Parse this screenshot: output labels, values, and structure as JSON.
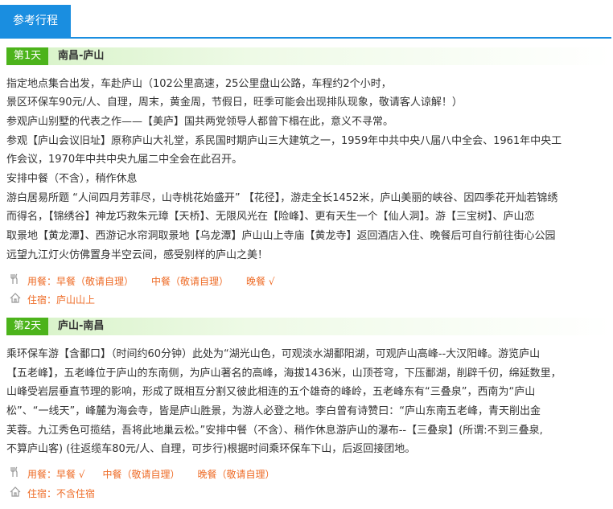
{
  "tab": {
    "label": "参考行程"
  },
  "days": [
    {
      "badge": "第1天",
      "title": "南昌-庐山",
      "lines": [
        "指定地点集合出发，车赴庐山（102公里高速，25公里盘山公路，车程约2个小时，",
        "景区环保车90元/人、自理，周末，黄金周，节假日，旺季可能会出现排队现象，敬请客人谅解！）",
        "参观庐山别墅的代表之作——【美庐】国共两党领导人都曾下榻在此，意义不寻常。",
        "参观【庐山会议旧址】原称庐山大礼堂，系民国时期庐山三大建筑之一，1959年中共中央八届八中全会、1961年中央工",
        "作会议，1970年中共中央九届二中全会在此召开。",
        "安排中餐（不含），稍作休息",
        "游白居易所题 “人间四月芳菲尽，山寺桃花始盛开” 【花径】，游走全长1452米，庐山美丽的峡谷、因四季花开灿若锦绣",
        "而得名，【锦绣谷】神龙巧救朱元璋【天桥】、无限风光在【险峰】、更有天生一个【仙人洞】。游【三宝树】、庐山恋",
        "取景地【黄龙潭】、西游记水帘洞取景地【乌龙潭】庐山山上寺庙【黄龙寺】返回酒店入住、晚餐后可自行前往街心公园",
        "远望九江灯火仿佛置身半空云间，感受别样的庐山之美！"
      ],
      "meals": [
        "用餐：早餐（敬请自理）",
        "中餐（敬请自理）",
        "晚餐 √"
      ],
      "stay": "住宿：庐山山上"
    },
    {
      "badge": "第2天",
      "title": "庐山-南昌",
      "lines": [
        "乘环保车游【含鄱口】（时间约60分钟）此处为“湖光山色，可观淡水湖鄱阳湖，可观庐山高峰--大汉阳峰。游览庐山",
        "【五老峰】，五老峰位于庐山的东南侧，为庐山著名的高峰，海拔1436米，山顶苍穹，下压鄱湖，削辟千仞，绵延数里，",
        "山峰受岩层垂直节理的影响，形成了既相互分割又彼此相连的五个雄奇的峰岭，五老峰东有“三叠泉”，西南为“庐山",
        "松”、“一线天”，峰麓为海会寺，皆是庐山胜景，为游人必登之地。李白曾有诗赞曰：“庐山东南五老峰，青天削出金",
        "芙蓉。九江秀色可揽结，吾将此地巢云松。”安排中餐（不含）、稍作休息游庐山的瀑布--【三叠泉】(所谓:不到三叠泉,",
        "不算庐山客) (往返缆车80元/人、自理，可步行)根据时间乘环保车下山，后返回接团地。"
      ],
      "meals": [
        "用餐：早餐 √",
        "中餐（敬请自理）",
        "晚餐（敬请自理）"
      ],
      "stay": "住宿：不含住宿"
    }
  ],
  "icons": {
    "meal": "fork-knife-icon",
    "stay": "house-icon"
  },
  "colors": {
    "accent": "#1a8ee0",
    "day_badge": "#4cb31b",
    "meal_text": "#ee6b26"
  }
}
